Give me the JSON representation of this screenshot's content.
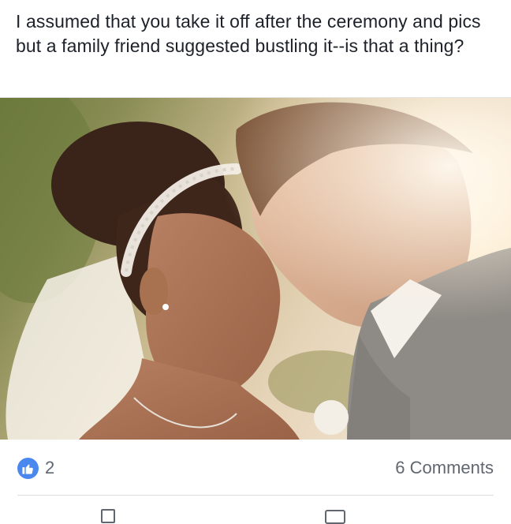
{
  "post": {
    "text": "I assumed that you take it off after the ceremony and pics but a family friend suggested bustling it--is that a thing?"
  },
  "footer": {
    "like_count": "2",
    "comments_label": "6 Comments"
  },
  "icons": {
    "like": "thumbs-up-icon",
    "like_color": "#4a88f0"
  },
  "colors": {
    "secondary_text": "#606770",
    "primary_text": "#1d2129"
  }
}
